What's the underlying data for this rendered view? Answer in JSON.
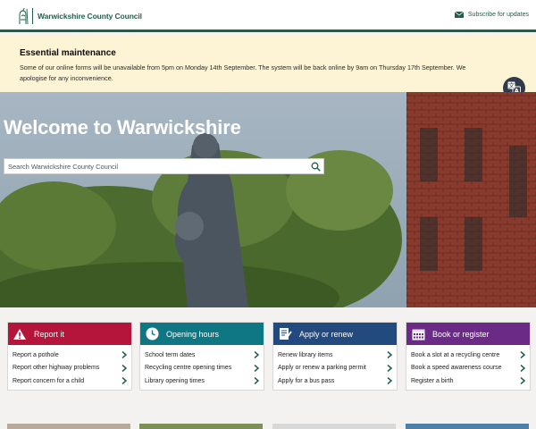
{
  "header": {
    "logo_text": "Warwickshire County Council",
    "subscribe_label": "Subscribe for updates",
    "brand_color": "#1f5f4c"
  },
  "banner": {
    "title": "Essential maintenance",
    "text": "Some of our online forms will be unavailable from 5pm on Monday 14th September. The system will be back online by 9am on Thursday 17th September. We apologise for any inconvenience.",
    "translate_icon": "translate-icon"
  },
  "hero": {
    "title": "Welcome to Warwickshire",
    "search_placeholder": "Search Warwickshire County Council"
  },
  "cards": [
    {
      "title": "Report it",
      "icon": "report-warning-icon",
      "color": "#b5153a",
      "items": [
        "Report a pothole",
        "Report other highway problems",
        "Report concern for a child"
      ]
    },
    {
      "title": "Opening hours",
      "icon": "clock-icon",
      "color": "#0f7783",
      "items": [
        "School term dates",
        "Recycling centre opening times",
        "Library opening times"
      ]
    },
    {
      "title": "Apply or renew",
      "icon": "application-form-icon",
      "color": "#234a7e",
      "items": [
        "Renew library items",
        "Apply or renew a parking permit",
        "Apply for a bus pass"
      ]
    },
    {
      "title": "Book or register",
      "icon": "calendar-icon",
      "color": "#6a2a86",
      "items": [
        "Book a slot at a recycling centre",
        "Book a speed awareness course",
        "Register a birth"
      ]
    }
  ]
}
